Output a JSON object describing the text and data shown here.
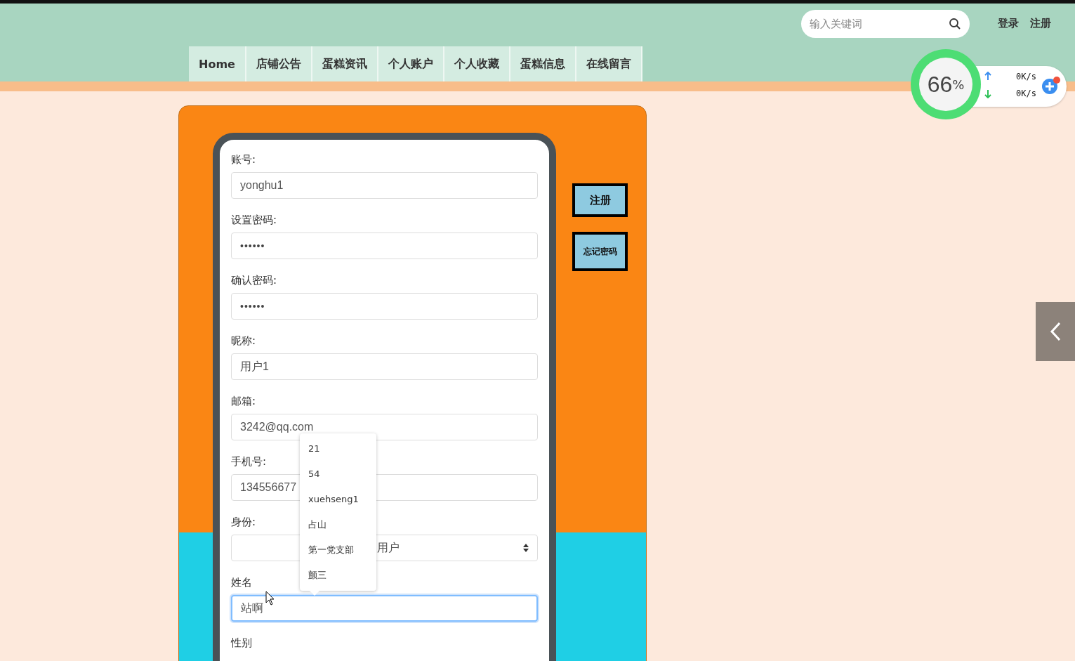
{
  "header": {
    "search": {
      "placeholder": "输入关键词"
    },
    "links": [
      "登录",
      "注册"
    ]
  },
  "nav": {
    "tabs": [
      "Home",
      "店铺公告",
      "蛋糕资讯",
      "个人账户",
      "个人收藏",
      "蛋糕信息",
      "在线留言"
    ]
  },
  "form": {
    "fields": [
      {
        "label": "账号:",
        "kind": "text",
        "value": "yonghu1",
        "focused": false
      },
      {
        "label": "设置密码:",
        "kind": "password",
        "value": "••••••",
        "focused": false
      },
      {
        "label": "确认密码:",
        "kind": "password",
        "value": "••••••",
        "focused": false
      },
      {
        "label": "昵称:",
        "kind": "text",
        "value": "用户1",
        "focused": false
      },
      {
        "label": "邮箱:",
        "kind": "text",
        "value": "3242@qq.com",
        "focused": false
      },
      {
        "label": "手机号:",
        "kind": "text",
        "value": "134556677",
        "focused": false
      },
      {
        "label": "身份:",
        "kind": "select",
        "value": "用户",
        "focused": false
      },
      {
        "label": "姓名",
        "kind": "text",
        "value": "站啊",
        "focused": true
      },
      {
        "label": "性别",
        "kind": "label_only"
      }
    ],
    "suggestions": [
      "21",
      "54",
      "xuehseng1",
      "占山",
      "第一党支部",
      "颤三"
    ]
  },
  "side_buttons": [
    "注册",
    "忘记密码"
  ],
  "speed_widget": {
    "percent": "66",
    "unit": "%",
    "upload": "0K/s",
    "download": "0K/s"
  }
}
